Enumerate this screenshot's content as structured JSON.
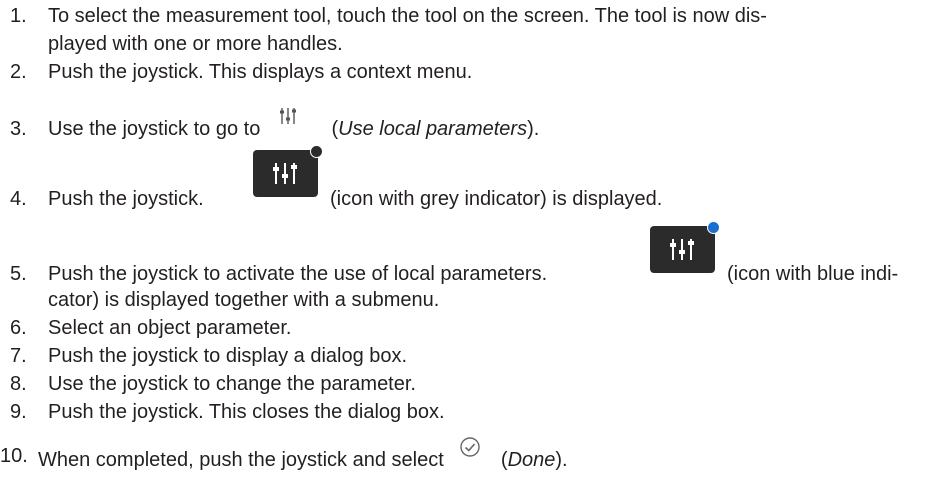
{
  "steps": [
    {
      "num": "1.",
      "line1": "To select the measurement tool, touch the tool on the screen. The tool is now dis-",
      "line2": "played with one or more handles."
    },
    {
      "num": "2.",
      "text": "Push the joystick. This displays a context menu."
    },
    {
      "num": "3.",
      "before": "Use the joystick to go to",
      "paren_open": "(",
      "em": "Use local parameters",
      "paren_close": ")."
    },
    {
      "num": "4.",
      "before": "Push the joystick.",
      "after": "(icon with grey indicator) is displayed."
    },
    {
      "num": "5.",
      "before": "Push the joystick to activate the use of local parameters.",
      "after": "(icon with blue indi-",
      "line2": "cator) is displayed together with a submenu."
    },
    {
      "num": "6.",
      "text": "Select an object parameter."
    },
    {
      "num": "7.",
      "text": "Push the joystick to display a dialog box."
    },
    {
      "num": "8.",
      "text": "Use the joystick to change the parameter."
    },
    {
      "num": "9.",
      "text": "Push the joystick. This closes the dialog box."
    },
    {
      "num": "10.",
      "before": "When completed, push the joystick and select",
      "paren_open": "(",
      "em": "Done",
      "paren_close": ")."
    }
  ],
  "icons": {
    "local_params_small": "sliders-icon",
    "local_params_grey": "sliders-icon-grey-indicator",
    "local_params_blue": "sliders-icon-blue-indicator",
    "done": "check-circle-icon"
  },
  "colors": {
    "text": "#231f20",
    "icon_bg": "#2b2b2b",
    "grey_indicator": "#2b2b2b",
    "blue_indicator": "#1a6fd1"
  }
}
